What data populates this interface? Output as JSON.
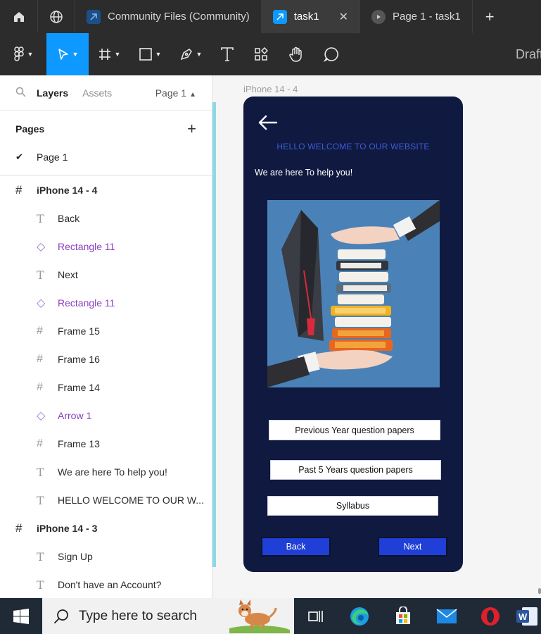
{
  "tabs": [
    {
      "label": "Community Files (Community)",
      "active": false
    },
    {
      "label": "task1",
      "active": true,
      "close": "✕"
    },
    {
      "label": "Page 1 - task1",
      "active": false
    }
  ],
  "toolbar": {
    "right_label": "Draft"
  },
  "panel": {
    "tab_layers": "Layers",
    "tab_assets": "Assets",
    "page_selector": "Page 1",
    "pages_title": "Pages",
    "pages": [
      {
        "label": "Page 1",
        "selected": true
      }
    ],
    "layers": [
      {
        "type": "frame",
        "label": "iPhone 14 - 4"
      },
      {
        "type": "text",
        "label": "Back"
      },
      {
        "type": "comp",
        "label": "Rectangle 11"
      },
      {
        "type": "text",
        "label": "Next"
      },
      {
        "type": "comp",
        "label": "Rectangle 11"
      },
      {
        "type": "subframe",
        "label": "Frame 15"
      },
      {
        "type": "subframe",
        "label": "Frame 16"
      },
      {
        "type": "subframe",
        "label": "Frame 14"
      },
      {
        "type": "comp",
        "label": "Arrow 1"
      },
      {
        "type": "subframe",
        "label": "Frame 13"
      },
      {
        "type": "text",
        "label": "We are here To help you!"
      },
      {
        "type": "text",
        "label": "HELLO WELCOME TO OUR W..."
      },
      {
        "type": "frame",
        "label": "iPhone 14 - 3"
      },
      {
        "type": "text",
        "label": "Sign Up"
      },
      {
        "type": "text",
        "label": "Don't have an Account?"
      }
    ]
  },
  "canvas": {
    "frame_label": "iPhone 14 - 4",
    "hello": "HELLO  WELCOME TO OUR WEBSITE",
    "help": "We are here To help you!",
    "btn_prev": "Previous Year question papers",
    "btn_past": "Past 5 Years  question papers",
    "btn_syllabus": "Syllabus",
    "btn_back": "Back",
    "btn_next": "Next"
  },
  "taskbar": {
    "search_placeholder": "Type here to search"
  },
  "colors": {
    "accent": "#0d99ff",
    "phone_bg": "#101a40",
    "nav_button": "#1f3fd6",
    "component_purple": "#8a3fbf"
  }
}
